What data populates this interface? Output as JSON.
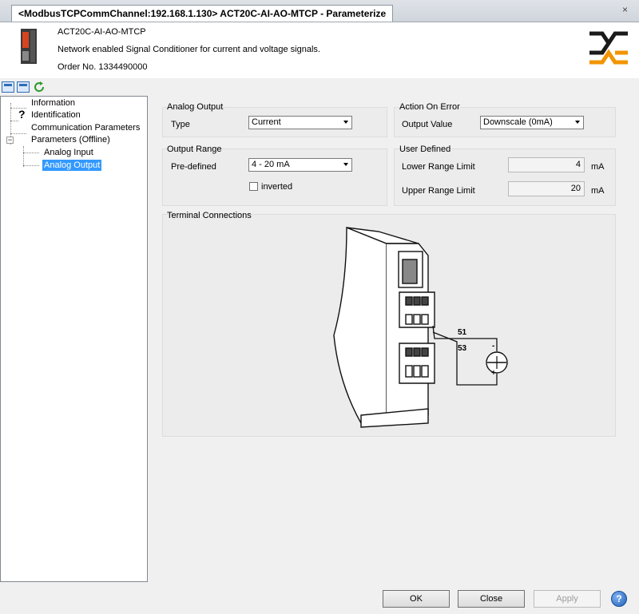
{
  "tab": {
    "title": "<ModbusTCPCommChannel:192.168.1.130> ACT20C-AI-AO-MTCP - Parameterize",
    "close_label": "×"
  },
  "header": {
    "device_name": "ACT20C-AI-AO-MTCP",
    "description": "Network enabled Signal Conditioner for current and voltage signals.",
    "order_no": "Order No. 1334490000"
  },
  "tree": {
    "items": [
      {
        "label": "Information"
      },
      {
        "label": "Identification"
      },
      {
        "label": "Communication Parameters"
      },
      {
        "label": "Parameters (Offline)"
      },
      {
        "label": "Analog Input"
      },
      {
        "label": "Analog Output"
      }
    ]
  },
  "analog_output": {
    "title": "Analog Output",
    "type_label": "Type",
    "type_value": "Current"
  },
  "action_on_error": {
    "title": "Action On Error",
    "output_label": "Output Value",
    "output_value": "Downscale (0mA)"
  },
  "output_range": {
    "title": "Output Range",
    "predefined_label": "Pre-defined",
    "predefined_value": "4 - 20 mA",
    "inverted_label": "inverted"
  },
  "user_defined": {
    "title": "User Defined",
    "lower_label": "Lower Range Limit",
    "lower_value": "4",
    "lower_unit": "mA",
    "upper_label": "Upper Range Limit",
    "upper_value": "20",
    "upper_unit": "mA"
  },
  "terminal": {
    "title": "Terminal Connections",
    "terminal_a": "51",
    "terminal_b": "53",
    "minus": "-",
    "plus": "+"
  },
  "buttons": {
    "ok": "OK",
    "close": "Close",
    "apply": "Apply",
    "help": "?"
  },
  "colors": {
    "accent": "#3399ff",
    "logo_black": "#1a1a1a",
    "logo_orange": "#f29400"
  }
}
